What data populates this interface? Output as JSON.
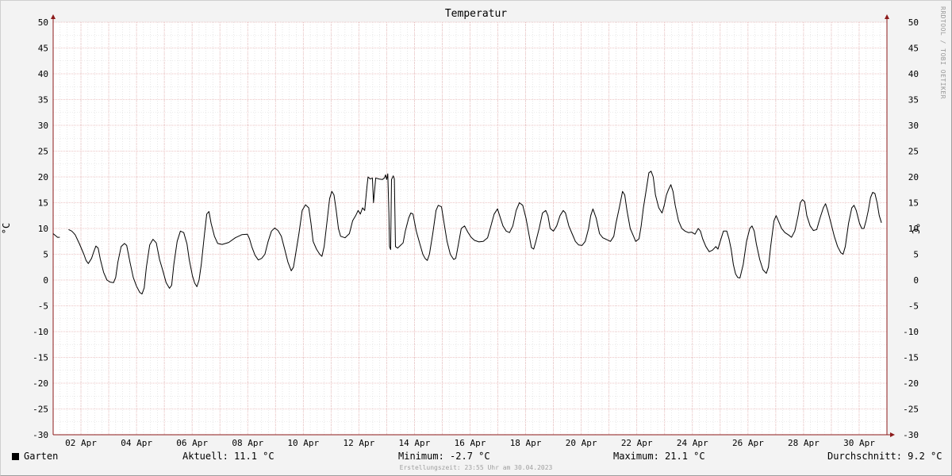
{
  "chart_data": {
    "type": "line",
    "title": "Temperatur",
    "ylabel": "°C",
    "ylabel_right": "°C",
    "ylim": [
      -30,
      50
    ],
    "yticks": [
      "50",
      "45",
      "40",
      "35",
      "30",
      "25",
      "20",
      "15",
      "10",
      "5",
      "0",
      "-5",
      "-10",
      "-15",
      "-20",
      "-25",
      "-30"
    ],
    "xlim_days": [
      0,
      30
    ],
    "xtick_labels": [
      "02 Apr",
      "04 Apr",
      "06 Apr",
      "08 Apr",
      "10 Apr",
      "12 Apr",
      "14 Apr",
      "16 Apr",
      "18 Apr",
      "20 Apr",
      "22 Apr",
      "24 Apr",
      "26 Apr",
      "28 Apr",
      "30 Apr"
    ],
    "grid": true,
    "legend_position": "bottom-left",
    "series": [
      {
        "name": "Garten",
        "color": "#000000",
        "points": [
          [
            0.0,
            9.0
          ],
          [
            0.2,
            8.3
          ],
          [
            0.3,
            8.3
          ],
          [
            0.35,
            null
          ],
          [
            0.65,
            null
          ],
          [
            0.7,
            9.8
          ],
          [
            0.85,
            9.5
          ],
          [
            1.0,
            8.8
          ],
          [
            1.2,
            7.0
          ],
          [
            1.4,
            5.0
          ],
          [
            1.5,
            3.8
          ],
          [
            1.6,
            3.2
          ],
          [
            1.75,
            4.2
          ],
          [
            1.85,
            5.5
          ],
          [
            1.95,
            6.6
          ],
          [
            2.05,
            6.2
          ],
          [
            2.15,
            4.0
          ],
          [
            2.3,
            1.5
          ],
          [
            2.45,
            0.0
          ],
          [
            2.6,
            -0.4
          ],
          [
            2.75,
            -0.5
          ],
          [
            2.85,
            0.5
          ],
          [
            2.95,
            3.5
          ],
          [
            3.1,
            6.5
          ],
          [
            3.25,
            7.1
          ],
          [
            3.35,
            6.7
          ],
          [
            3.5,
            3.5
          ],
          [
            3.65,
            0.5
          ],
          [
            3.8,
            -1.2
          ],
          [
            3.95,
            -2.4
          ],
          [
            4.05,
            -2.7
          ],
          [
            4.15,
            -1.5
          ],
          [
            4.25,
            2.5
          ],
          [
            4.4,
            6.8
          ],
          [
            4.55,
            7.9
          ],
          [
            4.7,
            7.2
          ],
          [
            4.85,
            4.0
          ],
          [
            5.0,
            1.8
          ],
          [
            5.15,
            -0.5
          ],
          [
            5.3,
            -1.6
          ],
          [
            5.4,
            -1.0
          ],
          [
            5.5,
            3.0
          ],
          [
            5.65,
            7.5
          ],
          [
            5.8,
            9.5
          ],
          [
            5.95,
            9.2
          ],
          [
            6.1,
            7.0
          ],
          [
            6.2,
            4.0
          ],
          [
            6.35,
            0.8
          ],
          [
            6.45,
            -0.6
          ],
          [
            6.55,
            -1.3
          ],
          [
            6.65,
            0.0
          ],
          [
            6.75,
            3.0
          ],
          [
            6.9,
            9.0
          ],
          [
            7.0,
            12.8
          ],
          [
            7.1,
            13.3
          ],
          [
            7.2,
            11.0
          ],
          [
            7.35,
            8.5
          ],
          [
            7.5,
            7.1
          ],
          [
            7.7,
            6.9
          ],
          [
            8.0,
            7.3
          ],
          [
            8.3,
            8.2
          ],
          [
            8.6,
            8.8
          ],
          [
            8.85,
            8.9
          ],
          [
            8.95,
            8.0
          ],
          [
            9.05,
            6.5
          ],
          [
            9.2,
            4.8
          ],
          [
            9.35,
            3.9
          ],
          [
            9.5,
            4.2
          ],
          [
            9.65,
            5.0
          ],
          [
            9.8,
            7.5
          ],
          [
            9.95,
            9.5
          ],
          [
            10.1,
            10.1
          ],
          [
            10.25,
            9.6
          ],
          [
            10.4,
            8.5
          ],
          [
            10.55,
            6.0
          ],
          [
            10.7,
            3.5
          ],
          [
            10.85,
            1.8
          ],
          [
            10.95,
            2.5
          ],
          [
            11.05,
            5.0
          ],
          [
            11.2,
            9.0
          ],
          [
            11.35,
            13.5
          ],
          [
            11.5,
            14.6
          ],
          [
            11.65,
            14.0
          ],
          [
            11.75,
            11.0
          ],
          [
            11.85,
            7.5
          ],
          [
            12.0,
            6.0
          ],
          [
            12.15,
            5.0
          ],
          [
            12.25,
            4.6
          ],
          [
            12.35,
            6.5
          ],
          [
            12.5,
            12.0
          ],
          [
            12.6,
            15.8
          ],
          [
            12.7,
            17.2
          ],
          [
            12.8,
            16.5
          ],
          [
            12.9,
            13.5
          ],
          [
            13.0,
            10.0
          ],
          [
            13.1,
            8.5
          ],
          [
            13.3,
            8.2
          ],
          [
            13.5,
            9.0
          ],
          [
            13.65,
            11.5
          ],
          [
            13.8,
            12.6
          ],
          [
            13.9,
            13.5
          ],
          [
            14.0,
            12.8
          ],
          [
            14.1,
            14.0
          ],
          [
            14.2,
            13.5
          ],
          [
            14.3,
            18.0
          ],
          [
            14.35,
            20.0
          ],
          [
            14.45,
            19.6
          ],
          [
            14.55,
            19.8
          ],
          [
            14.6,
            15.0
          ],
          [
            14.7,
            19.8
          ],
          [
            14.85,
            19.6
          ],
          [
            15.0,
            19.5
          ],
          [
            15.1,
            19.8
          ],
          [
            15.15,
            20.4
          ],
          [
            15.2,
            19.5
          ],
          [
            15.25,
            20.6
          ],
          [
            15.3,
            13.0
          ],
          [
            15.33,
            6.5
          ],
          [
            15.38,
            5.9
          ],
          [
            15.42,
            19.5
          ],
          [
            15.5,
            20.2
          ],
          [
            15.55,
            19.6
          ],
          [
            15.6,
            6.5
          ],
          [
            15.7,
            6.2
          ],
          [
            15.85,
            6.8
          ],
          [
            15.95,
            7.2
          ],
          [
            16.05,
            9.5
          ],
          [
            16.2,
            12.0
          ],
          [
            16.3,
            13.0
          ],
          [
            16.4,
            12.8
          ],
          [
            16.55,
            9.5
          ],
          [
            16.7,
            7.2
          ],
          [
            16.85,
            5.0
          ],
          [
            16.95,
            4.2
          ],
          [
            17.05,
            3.8
          ],
          [
            17.15,
            5.0
          ],
          [
            17.3,
            9.0
          ],
          [
            17.45,
            13.5
          ],
          [
            17.55,
            14.5
          ],
          [
            17.7,
            14.2
          ],
          [
            17.8,
            11.5
          ],
          [
            17.95,
            7.5
          ],
          [
            18.1,
            5.0
          ],
          [
            18.25,
            4.0
          ],
          [
            18.35,
            4.2
          ],
          [
            18.45,
            6.5
          ],
          [
            18.6,
            10.0
          ],
          [
            18.75,
            10.5
          ],
          [
            18.9,
            9.3
          ],
          [
            19.05,
            8.3
          ],
          [
            19.2,
            7.7
          ],
          [
            19.4,
            7.4
          ],
          [
            19.6,
            7.5
          ],
          [
            19.8,
            8.2
          ],
          [
            19.95,
            10.5
          ],
          [
            20.1,
            12.8
          ],
          [
            20.25,
            13.8
          ],
          [
            20.35,
            12.5
          ],
          [
            20.5,
            10.5
          ],
          [
            20.65,
            9.5
          ],
          [
            20.8,
            9.2
          ],
          [
            20.95,
            10.5
          ],
          [
            21.1,
            13.5
          ],
          [
            21.25,
            15.0
          ],
          [
            21.4,
            14.5
          ],
          [
            21.55,
            12.0
          ],
          [
            21.7,
            8.5
          ],
          [
            21.8,
            6.3
          ],
          [
            21.9,
            6.0
          ],
          [
            22.0,
            7.5
          ],
          [
            22.15,
            10.0
          ],
          [
            22.3,
            13.0
          ],
          [
            22.45,
            13.5
          ],
          [
            22.55,
            12.5
          ],
          [
            22.65,
            10.0
          ],
          [
            22.8,
            9.5
          ],
          [
            22.95,
            10.5
          ],
          [
            23.1,
            12.5
          ],
          [
            23.25,
            13.5
          ],
          [
            23.35,
            13.0
          ],
          [
            23.5,
            10.5
          ],
          [
            23.65,
            9.0
          ],
          [
            23.8,
            7.5
          ],
          [
            23.95,
            6.8
          ],
          [
            24.1,
            6.7
          ],
          [
            24.25,
            7.5
          ],
          [
            24.4,
            10.0
          ],
          [
            24.5,
            12.5
          ],
          [
            24.6,
            13.8
          ],
          [
            24.75,
            12.0
          ],
          [
            24.9,
            9.0
          ],
          [
            25.05,
            8.2
          ],
          [
            25.25,
            7.8
          ],
          [
            25.4,
            7.5
          ],
          [
            25.55,
            8.5
          ],
          [
            25.65,
            11.0
          ],
          [
            25.8,
            14.0
          ],
          [
            25.95,
            17.2
          ],
          [
            26.05,
            16.5
          ],
          [
            26.15,
            13.5
          ],
          [
            26.3,
            10.0
          ],
          [
            26.45,
            8.5
          ],
          [
            26.55,
            7.5
          ],
          [
            26.7,
            8.0
          ],
          [
            26.8,
            10.5
          ],
          [
            26.9,
            14.0
          ],
          [
            27.05,
            18.0
          ],
          [
            27.15,
            20.8
          ],
          [
            27.25,
            21.1
          ],
          [
            27.35,
            20.0
          ],
          [
            27.45,
            16.5
          ],
          [
            27.6,
            14.0
          ],
          [
            27.75,
            13.0
          ],
          [
            27.85,
            14.5
          ],
          [
            27.95,
            16.5
          ],
          [
            28.05,
            17.6
          ],
          [
            28.15,
            18.5
          ],
          [
            28.25,
            17.2
          ],
          [
            28.35,
            14.5
          ],
          [
            28.5,
            11.5
          ],
          [
            28.65,
            10.0
          ],
          [
            28.8,
            9.5
          ],
          [
            28.95,
            9.2
          ],
          [
            29.1,
            9.3
          ],
          [
            29.25,
            8.9
          ],
          [
            29.4,
            10.0
          ],
          [
            29.5,
            9.5
          ],
          [
            29.6,
            8.0
          ],
          [
            29.75,
            6.5
          ],
          [
            29.9,
            5.5
          ],
          [
            30.05,
            5.8
          ],
          [
            30.2,
            6.5
          ],
          [
            30.3,
            6.0
          ],
          [
            30.4,
            7.5
          ],
          [
            30.55,
            9.5
          ],
          [
            30.7,
            9.5
          ],
          [
            30.8,
            8.0
          ],
          [
            30.9,
            6.0
          ],
          [
            31.0,
            3.0
          ],
          [
            31.1,
            1.2
          ],
          [
            31.2,
            0.5
          ],
          [
            31.3,
            0.4
          ],
          [
            31.45,
            3.0
          ],
          [
            31.6,
            7.5
          ],
          [
            31.75,
            10.0
          ],
          [
            31.85,
            10.5
          ],
          [
            31.95,
            9.5
          ],
          [
            32.05,
            7.0
          ],
          [
            32.2,
            4.0
          ],
          [
            32.35,
            2.0
          ],
          [
            32.5,
            1.3
          ],
          [
            32.6,
            2.5
          ],
          [
            32.7,
            6.5
          ],
          [
            32.85,
            11.5
          ],
          [
            32.95,
            12.5
          ],
          [
            33.05,
            11.5
          ],
          [
            33.2,
            10.0
          ],
          [
            33.35,
            9.2
          ],
          [
            33.5,
            8.8
          ],
          [
            33.65,
            8.3
          ],
          [
            33.8,
            9.5
          ],
          [
            33.95,
            12.5
          ],
          [
            34.05,
            15.0
          ],
          [
            34.15,
            15.6
          ],
          [
            34.25,
            15.2
          ],
          [
            34.35,
            12.5
          ],
          [
            34.5,
            10.5
          ],
          [
            34.65,
            9.6
          ],
          [
            34.8,
            9.8
          ],
          [
            34.95,
            12.0
          ],
          [
            35.1,
            14.0
          ],
          [
            35.2,
            14.8
          ],
          [
            35.3,
            13.5
          ],
          [
            35.45,
            11.0
          ],
          [
            35.6,
            8.5
          ],
          [
            35.75,
            6.5
          ],
          [
            35.9,
            5.3
          ],
          [
            36.0,
            5.0
          ],
          [
            36.1,
            6.5
          ],
          [
            36.25,
            11.0
          ],
          [
            36.4,
            14.0
          ],
          [
            36.5,
            14.5
          ],
          [
            36.6,
            13.5
          ],
          [
            36.75,
            11.0
          ],
          [
            36.85,
            10.0
          ],
          [
            36.95,
            10.0
          ],
          [
            37.05,
            11.5
          ],
          [
            37.15,
            13.5
          ],
          [
            37.25,
            16.0
          ],
          [
            37.35,
            17.0
          ],
          [
            37.45,
            16.8
          ],
          [
            37.55,
            15.0
          ],
          [
            37.65,
            12.5
          ],
          [
            37.75,
            11.1
          ]
        ]
      }
    ]
  },
  "legend": {
    "name": "Garten",
    "swatch_color": "#000000"
  },
  "stats": {
    "current": "Aktuell: 11.1 °C",
    "minimum": "Minimum: -2.7 °C",
    "maximum": "Maximum: 21.1 °C",
    "average": "Durchschnitt: 9.2 °C"
  },
  "footer": "Erstellungszeit: 23:55 Uhr am 30.04.2023",
  "watermark": "RRDTOOL / TOBI OETIKER",
  "colors": {
    "background": "#f3f3f3",
    "plot": "#ffffff",
    "minor_grid": "#d8d8d8",
    "major_grid": "#e8b4b4",
    "axis": "#8c1a1a"
  }
}
